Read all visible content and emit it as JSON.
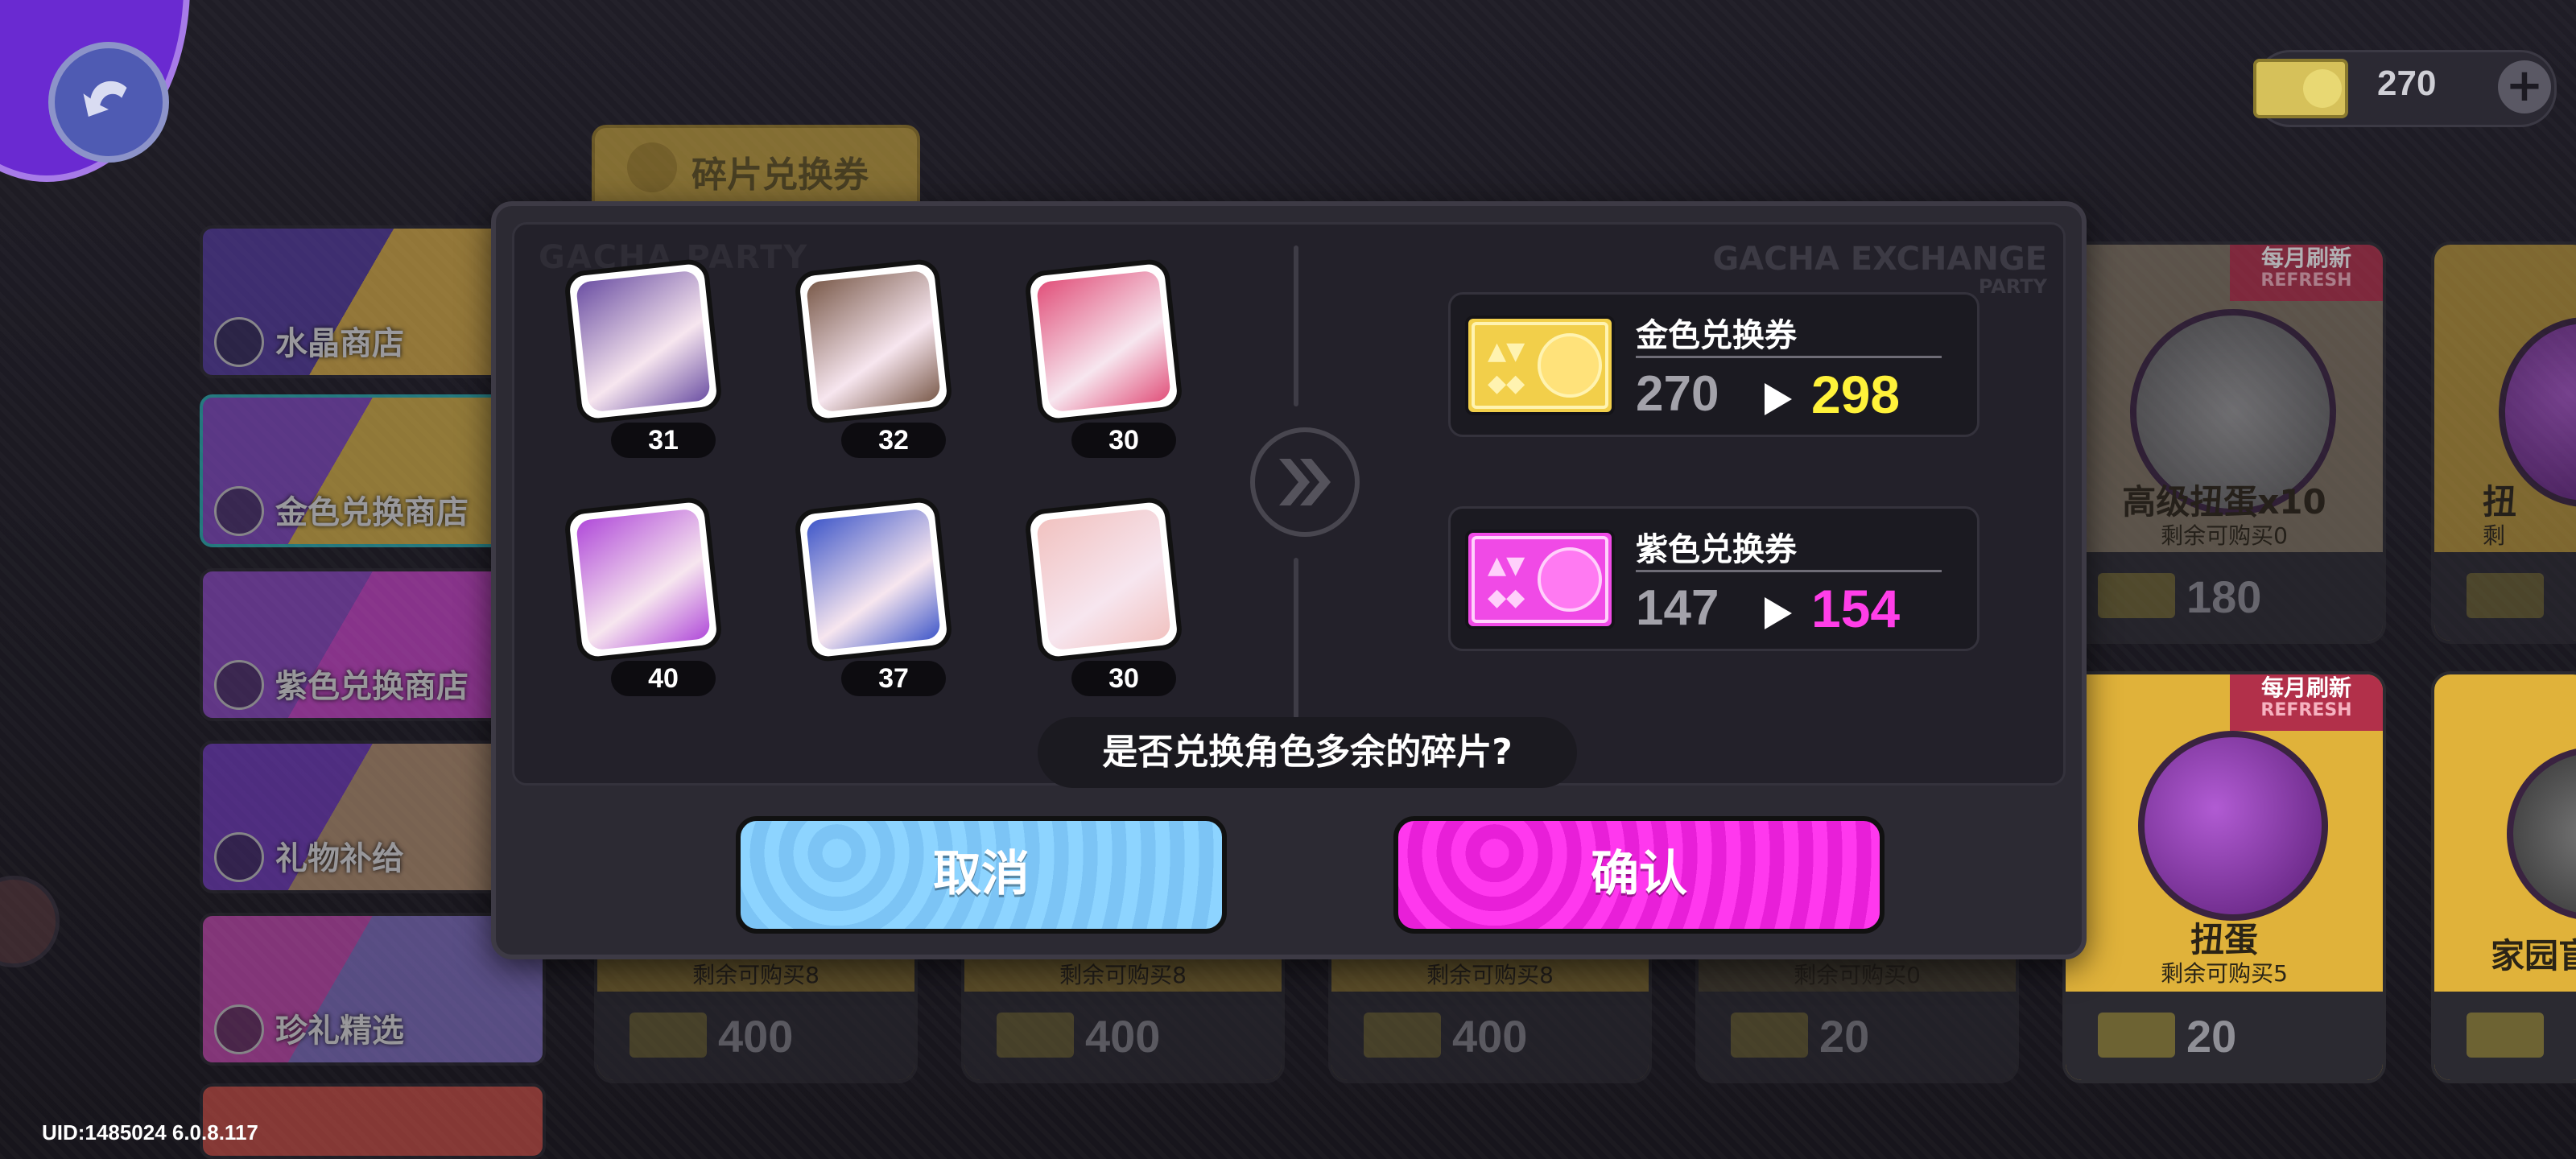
{
  "topbar": {
    "currency_value": "270",
    "currency_icon": "gold-ticket-icon",
    "add_icon": "plus-icon"
  },
  "category_tab": {
    "label": "碎片兑换券"
  },
  "sidebar": {
    "items": [
      {
        "label": "水晶商店",
        "icon": "crystal-shop-icon"
      },
      {
        "label": "金色兑换商店",
        "icon": "gold-exchange-icon"
      },
      {
        "label": "紫色兑换商店",
        "icon": "purple-exchange-icon"
      },
      {
        "label": "礼物补给",
        "icon": "gift-icon"
      },
      {
        "label": "珍礼精选",
        "icon": "treasure-icon"
      }
    ]
  },
  "shop_cards": [
    {
      "remain": "剩余可购买8",
      "price": "400"
    },
    {
      "remain": "剩余可购买8",
      "price": "400"
    },
    {
      "remain": "剩余可购买8",
      "price": "400"
    },
    {
      "remain": "剩余可购买0",
      "price": "20"
    },
    {
      "title": "高级扭蛋x10",
      "remain": "剩余可购买0",
      "price": "180",
      "badge": "每月刷新",
      "badge_sub": "REFRESH"
    },
    {
      "title": "扭蛋",
      "remain": "剩余可购买5",
      "price": "20",
      "badge": "每月刷新",
      "badge_sub": "REFRESH"
    },
    {
      "title": "扭",
      "remain": "剩",
      "price": ""
    },
    {
      "title": "家园盲盒",
      "remain": "",
      "price": ""
    }
  ],
  "modal": {
    "watermark_left": "GACHA PARTY",
    "watermark_right": "GACHA EXCHANGE",
    "watermark_right_sub": "PARTY",
    "fragments": [
      {
        "count": "31",
        "color": "#6b4fa3"
      },
      {
        "count": "32",
        "color": "#7a5a4a"
      },
      {
        "count": "30",
        "color": "#e1507a"
      },
      {
        "count": "40",
        "color": "#b04ad9"
      },
      {
        "count": "37",
        "color": "#3f57c9"
      },
      {
        "count": "30",
        "color": "#f1c2c0"
      }
    ],
    "gold": {
      "name": "金色兑换券",
      "from": "270",
      "to": "298",
      "color": "#fff23a"
    },
    "purple": {
      "name": "紫色兑换券",
      "from": "147",
      "to": "154",
      "color": "#ff3ee8"
    },
    "question": "是否兑换角色多余的碎片?",
    "cancel_label": "取消",
    "confirm_label": "确认"
  },
  "footer": {
    "uid": "UID:1485024 6.0.8.117"
  }
}
